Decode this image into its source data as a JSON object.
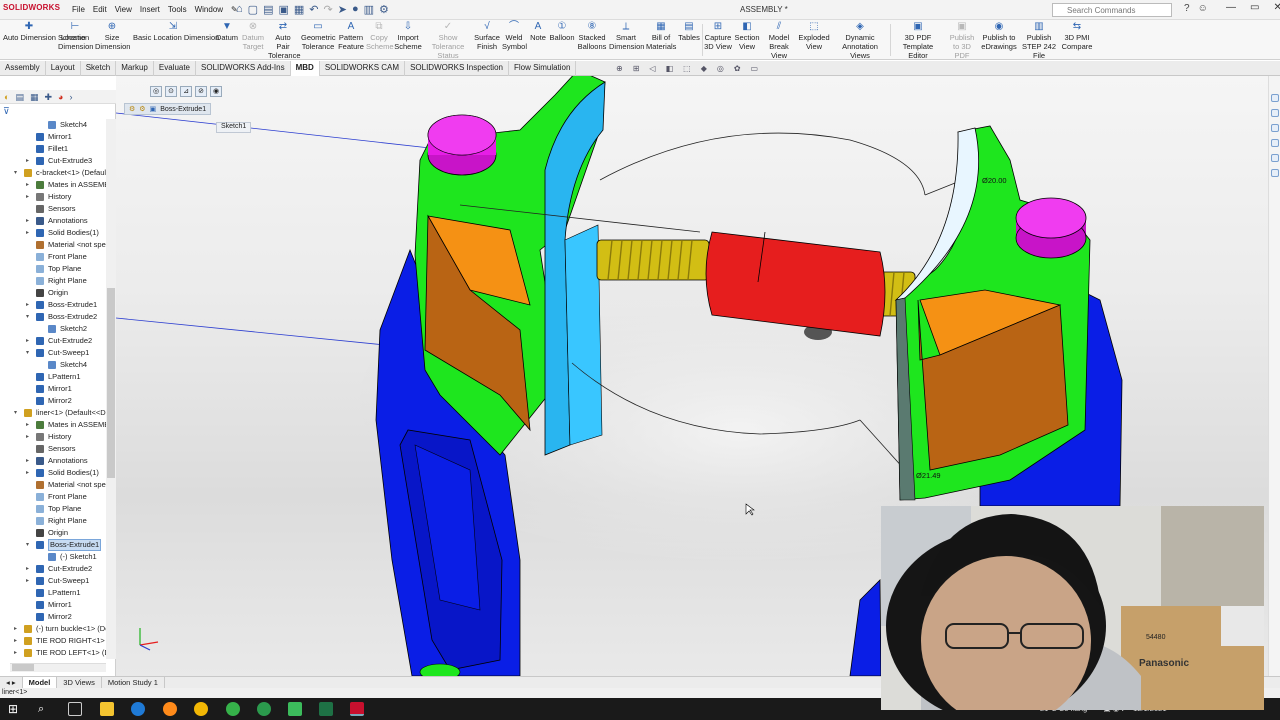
{
  "app": {
    "name": "SOLIDWORKS",
    "document_title": "ASSEMBLY *"
  },
  "menu": [
    "File",
    "Edit",
    "View",
    "Insert",
    "Tools",
    "Window"
  ],
  "search": {
    "placeholder": "Search Commands"
  },
  "ribbon": [
    "Auto Dimension Scheme",
    "Location Dimension",
    "Size Dimension",
    "Basic Location Dimension",
    "Datum",
    "Datum Target",
    "Auto Pair Tolerance",
    "Geometric Tolerance",
    "Pattern Feature",
    "Copy Scheme",
    "Import Scheme",
    "Show Tolerance Status",
    "Surface Finish",
    "Weld Symbol",
    "Note",
    "Balloon",
    "Stacked Balloons",
    "Smart Dimension",
    "Bill of Materials",
    "Tables",
    "Capture 3D View",
    "Section View",
    "Model Break View",
    "Exploded View",
    "Dynamic Annotation Views",
    "3D PDF Template Editor",
    "Publish to 3D PDF",
    "Publish to eDrawings",
    "Publish STEP 242 File",
    "3D PMI Compare"
  ],
  "tabs": [
    "Assembly",
    "Layout",
    "Sketch",
    "Markup",
    "Evaluate",
    "SOLIDWORKS Add-Ins",
    "MBD",
    "SOLIDWORKS CAM",
    "SOLIDWORKS Inspection",
    "Flow Simulation"
  ],
  "active_tab": "MBD",
  "tree": [
    {
      "label": "Sketch4",
      "indent": 2,
      "icon": "sketch"
    },
    {
      "label": "Mirror1",
      "indent": 1,
      "icon": "feature"
    },
    {
      "label": "Fillet1",
      "indent": 1,
      "icon": "feature"
    },
    {
      "label": "Cut-Extrude3",
      "indent": 1,
      "icon": "feature",
      "arrow": "▸"
    },
    {
      "label": "c-bracket<1> (Default<",
      "indent": 0,
      "icon": "part",
      "arrow": "▾"
    },
    {
      "label": "Mates in ASSEMBLY",
      "indent": 1,
      "icon": "mates",
      "arrow": "▸"
    },
    {
      "label": "History",
      "indent": 1,
      "icon": "history",
      "arrow": "▸"
    },
    {
      "label": "Sensors",
      "indent": 1,
      "icon": "sensor"
    },
    {
      "label": "Annotations",
      "indent": 1,
      "icon": "annot",
      "arrow": "▸"
    },
    {
      "label": "Solid Bodies(1)",
      "indent": 1,
      "icon": "body",
      "arrow": "▸"
    },
    {
      "label": "Material <not specif",
      "indent": 1,
      "icon": "material"
    },
    {
      "label": "Front Plane",
      "indent": 1,
      "icon": "plane"
    },
    {
      "label": "Top Plane",
      "indent": 1,
      "icon": "plane"
    },
    {
      "label": "Right Plane",
      "indent": 1,
      "icon": "plane"
    },
    {
      "label": "Origin",
      "indent": 1,
      "icon": "origin"
    },
    {
      "label": "Boss-Extrude1",
      "indent": 1,
      "icon": "feature",
      "arrow": "▸"
    },
    {
      "label": "Boss-Extrude2",
      "indent": 1,
      "icon": "feature",
      "arrow": "▾"
    },
    {
      "label": "Sketch2",
      "indent": 2,
      "icon": "sketch"
    },
    {
      "label": "Cut-Extrude2",
      "indent": 1,
      "icon": "feature",
      "arrow": "▸"
    },
    {
      "label": "Cut-Sweep1",
      "indent": 1,
      "icon": "feature",
      "arrow": "▾"
    },
    {
      "label": "Sketch4",
      "indent": 2,
      "icon": "sketch"
    },
    {
      "label": "LPattern1",
      "indent": 1,
      "icon": "feature"
    },
    {
      "label": "Mirror1",
      "indent": 1,
      "icon": "feature"
    },
    {
      "label": "Mirror2",
      "indent": 1,
      "icon": "feature"
    },
    {
      "label": "liner<1> (Default<<Def",
      "indent": 0,
      "icon": "part",
      "arrow": "▾"
    },
    {
      "label": "Mates in ASSEMBLY",
      "indent": 1,
      "icon": "mates",
      "arrow": "▸"
    },
    {
      "label": "History",
      "indent": 1,
      "icon": "history",
      "arrow": "▸"
    },
    {
      "label": "Sensors",
      "indent": 1,
      "icon": "sensor"
    },
    {
      "label": "Annotations",
      "indent": 1,
      "icon": "annot",
      "arrow": "▸"
    },
    {
      "label": "Solid Bodies(1)",
      "indent": 1,
      "icon": "body",
      "arrow": "▸"
    },
    {
      "label": "Material <not specif",
      "indent": 1,
      "icon": "material"
    },
    {
      "label": "Front Plane",
      "indent": 1,
      "icon": "plane"
    },
    {
      "label": "Top Plane",
      "indent": 1,
      "icon": "plane"
    },
    {
      "label": "Right Plane",
      "indent": 1,
      "icon": "plane"
    },
    {
      "label": "Origin",
      "indent": 1,
      "icon": "origin"
    },
    {
      "label": "Boss-Extrude1",
      "indent": 1,
      "icon": "feature",
      "arrow": "▾",
      "selected": true
    },
    {
      "label": "(-) Sketch1",
      "indent": 2,
      "icon": "sketch"
    },
    {
      "label": "Cut-Extrude2",
      "indent": 1,
      "icon": "feature",
      "arrow": "▸"
    },
    {
      "label": "Cut-Sweep1",
      "indent": 1,
      "icon": "feature",
      "arrow": "▸"
    },
    {
      "label": "LPattern1",
      "indent": 1,
      "icon": "feature"
    },
    {
      "label": "Mirror1",
      "indent": 1,
      "icon": "feature"
    },
    {
      "label": "Mirror2",
      "indent": 1,
      "icon": "feature"
    },
    {
      "label": "(-) turn buckle<1> (Defa",
      "indent": 0,
      "icon": "part",
      "arrow": "▸"
    },
    {
      "label": "TIE ROD RIGHT<1> (De",
      "indent": 0,
      "icon": "part",
      "arrow": "▸"
    },
    {
      "label": "TIE ROD LEFT<1> (Defa",
      "indent": 0,
      "icon": "part",
      "arrow": "▸"
    }
  ],
  "viewport": {
    "breadcrumb_item": "Boss-Extrude1",
    "sketch_tag": "Sketch1",
    "dimensions": [
      "Ø20.00",
      "Ø21.49"
    ]
  },
  "bottom_tabs": [
    "Model",
    "3D Views",
    "Motion Study 1"
  ],
  "status": "liner<1>",
  "tray": {
    "weather": "21°C  Có nắng",
    "date": "12/1/2021"
  },
  "webcam": {
    "box_label_1": "54480",
    "box_label_2": "Panasonic"
  },
  "colors": {
    "part_blue": "#0a1ee6",
    "part_green": "#1ee61e",
    "magenta": "#e61ee6",
    "orange": "#f59114",
    "brown": "#b96414",
    "cyan": "#29b5f0",
    "red": "#e61e1e",
    "thread_yellow": "#d2be14"
  }
}
